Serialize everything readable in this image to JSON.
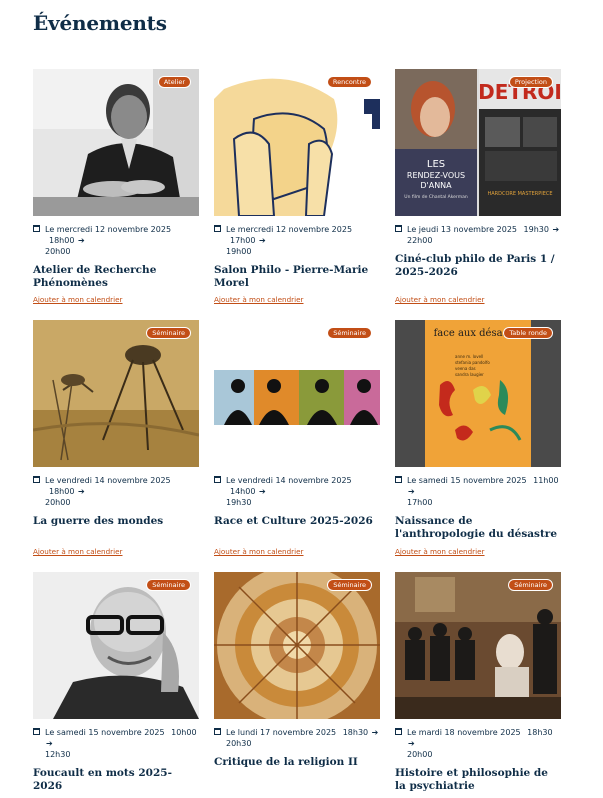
{
  "heading": "Événements",
  "add_label": "Ajouter à mon calendrier",
  "events": [
    {
      "badge": "Atelier",
      "date": "Le mercredi 12 novembre 2025",
      "start": "18h00",
      "end": "20h00",
      "title": "Atelier de Recherche Phénomènes"
    },
    {
      "badge": "Rencontre",
      "date": "Le mercredi 12 novembre 2025",
      "start": "17h00",
      "end": "19h00",
      "title": "Salon Philo - Pierre-Marie Morel"
    },
    {
      "badge": "Projection",
      "date": "Le jeudi 13 novembre 2025",
      "start": "19h30",
      "end": "22h00",
      "title": "Ciné-club philo de Paris 1 / 2025-2026"
    },
    {
      "badge": "Séminaire",
      "date": "Le vendredi 14 novembre 2025",
      "start": "18h00",
      "end": "20h00",
      "title": "La guerre des mondes"
    },
    {
      "badge": "Séminaire",
      "date": "Le vendredi 14 novembre 2025",
      "start": "14h00",
      "end": "19h30",
      "title": "Race et Culture 2025-2026"
    },
    {
      "badge": "Table ronde",
      "date": "Le samedi 15 novembre 2025",
      "start": "11h00",
      "end": "17h00",
      "title": "Naissance de l'anthropologie du désastre"
    },
    {
      "badge": "Séminaire",
      "date": "Le samedi 15 novembre 2025",
      "start": "10h00",
      "end": "12h30",
      "title": "Foucault en mots 2025-2026"
    },
    {
      "badge": "Séminaire",
      "date": "Le lundi 17 novembre 2025",
      "start": "18h30",
      "end": "20h30",
      "title": "Critique de la religion II"
    },
    {
      "badge": "Séminaire",
      "date": "Le mardi 18 novembre 2025",
      "start": "18h30",
      "end": "20h00",
      "title": "Histoire et philosophie de la psychiatrie"
    }
  ],
  "images": {
    "poster_left_text": "LES\nRENDEZ-VOUS\nD'ANNA",
    "poster_left_sub": "Un film de Chantal Akerman",
    "poster_right_text": "DETROI",
    "poster_right_tag": "HARDCORE MASTERPIECE",
    "book_title": "face aux désastre",
    "book_lines": [
      "anne m. lovell",
      "stefania pandolfo",
      "veena das",
      "sandra laugier"
    ]
  }
}
